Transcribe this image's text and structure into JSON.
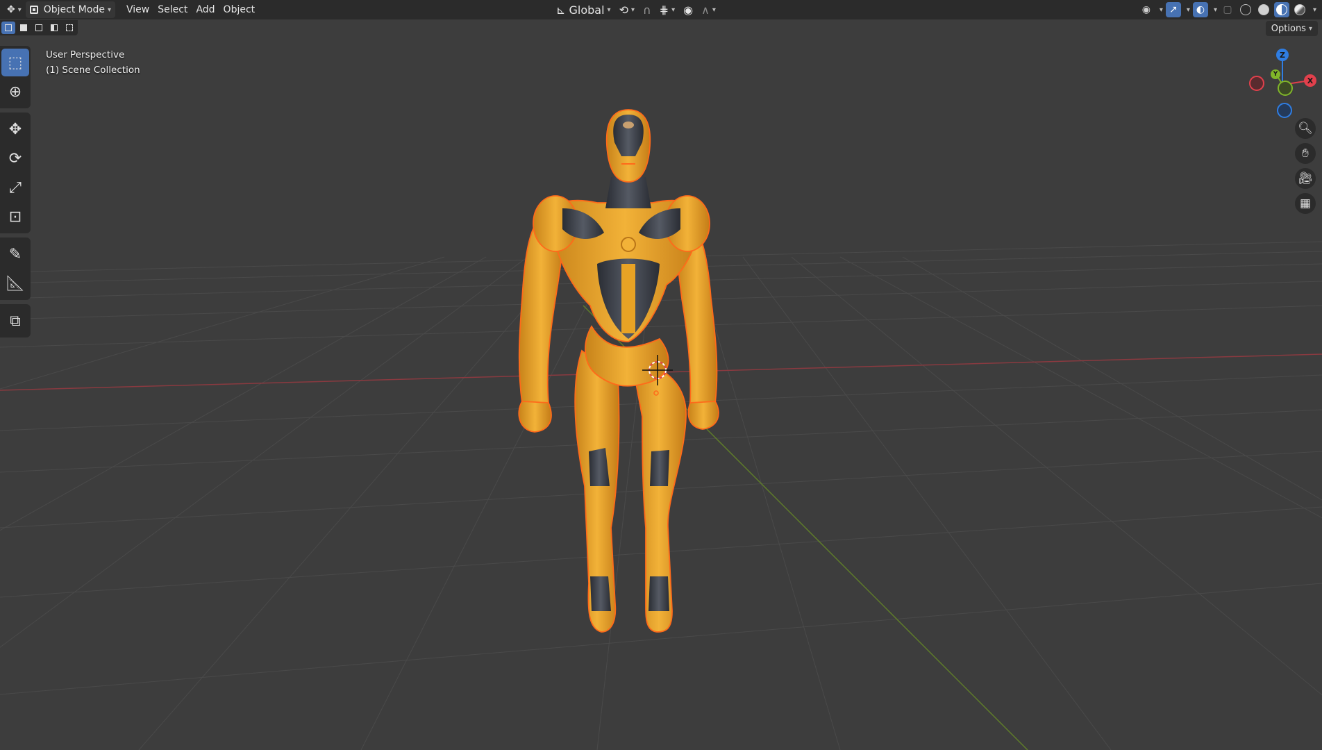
{
  "header": {
    "editor_type_icon": "editor-type-icon",
    "mode": "Object Mode",
    "menus": [
      "View",
      "Select",
      "Add",
      "Object"
    ],
    "transform_orientation": "Global",
    "pivot_icon": "pivot-point-icon",
    "snap_icon": "magnet-icon",
    "proportional_icon": "proportional-edit-icon"
  },
  "select_modes": [
    "select-new",
    "select-extend",
    "select-subtract",
    "select-invert",
    "select-intersect"
  ],
  "options_label": "Options",
  "overlay_text": {
    "view": "User Perspective",
    "collection": "(1) Scene Collection"
  },
  "toolbar": [
    [
      "select-box-icon",
      "cursor-icon"
    ],
    [
      "move-icon",
      "rotate-icon",
      "scale-icon",
      "transform-icon"
    ],
    [
      "annotate-icon",
      "measure-icon"
    ],
    [
      "add-cube-icon"
    ]
  ],
  "gizmo": {
    "x": "X",
    "y": "Y",
    "z": "Z"
  },
  "colors": {
    "accent": "#4772b3",
    "axis_x": "#e2404c",
    "axis_y": "#80b629",
    "axis_z": "#2f7de2",
    "robot_body": "#e8a325",
    "robot_dark": "#3b3f48",
    "selection_outline": "#ff6a1a"
  }
}
